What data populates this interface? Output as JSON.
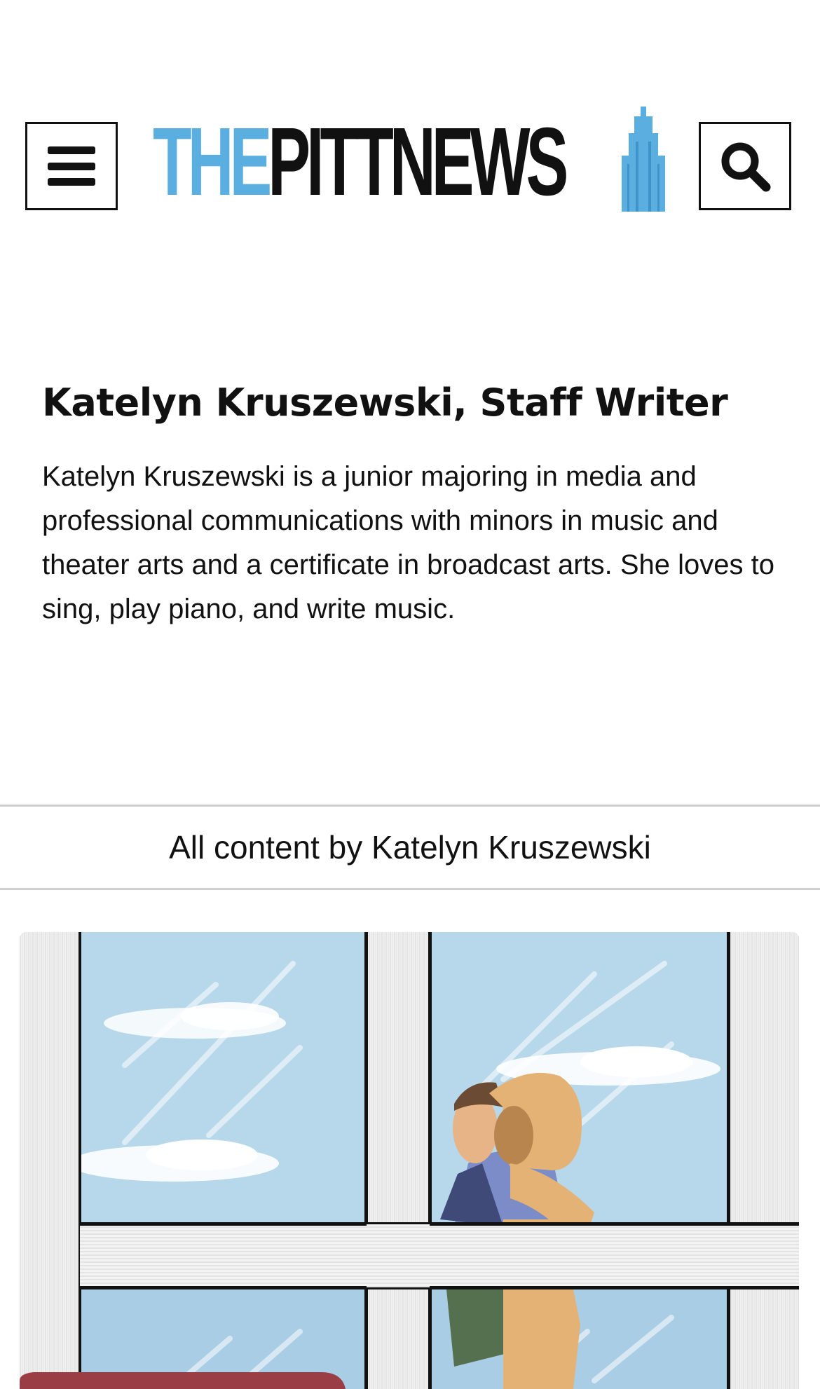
{
  "header": {
    "logo": {
      "part1": "THE",
      "part2": "PITTNEWS"
    },
    "menu_icon": "menu-icon",
    "search_icon": "search-icon",
    "colors": {
      "logo_blue": "#5aaee0",
      "logo_black": "#111111"
    }
  },
  "author": {
    "name": "Katelyn Kruszewski, Staff Writer",
    "bio": "Katelyn Kruszewski is a junior majoring in media and professional communications with minors in music and theater arts and a certificate in broadcast arts. She loves to sing, play piano, and write music."
  },
  "content_bar": {
    "label": "All content by Katelyn Kruszewski"
  }
}
